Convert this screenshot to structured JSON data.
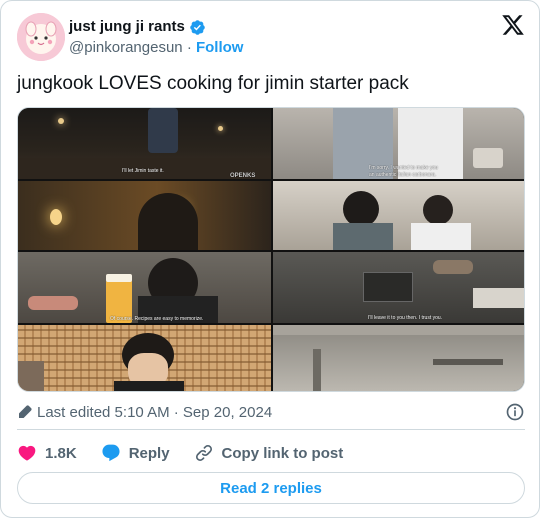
{
  "user": {
    "display_name": "just jung ji rants",
    "handle": "@pinkorangesun",
    "separator": "·",
    "follow_label": "Follow",
    "verified_color": "#1d9bf0"
  },
  "tweet": {
    "text": "jungkook LOVES cooking for jimin starter pack"
  },
  "media": {
    "subtitles": {
      "f1": "I'll let Jimin taste it.",
      "f1_watermark": "OPENKS",
      "f2a": "I'm sorry. I wanted to make you",
      "f2b": "an authentic Italian carbonara.",
      "f5": "Of course. Recipes are easy to memorize.",
      "f6": "I'll leave it to you then. I trust you."
    }
  },
  "meta": {
    "edited": "Last edited 5:10 AM · Sep 20, 2024"
  },
  "actions": {
    "likes": "1.8K",
    "reply_label": "Reply",
    "copy_label": "Copy link to post"
  },
  "read_replies": "Read 2 replies",
  "colors": {
    "like": "#f91880",
    "reply": "#1d9bf0",
    "link": "#1d9bf0",
    "muted": "#536471"
  }
}
